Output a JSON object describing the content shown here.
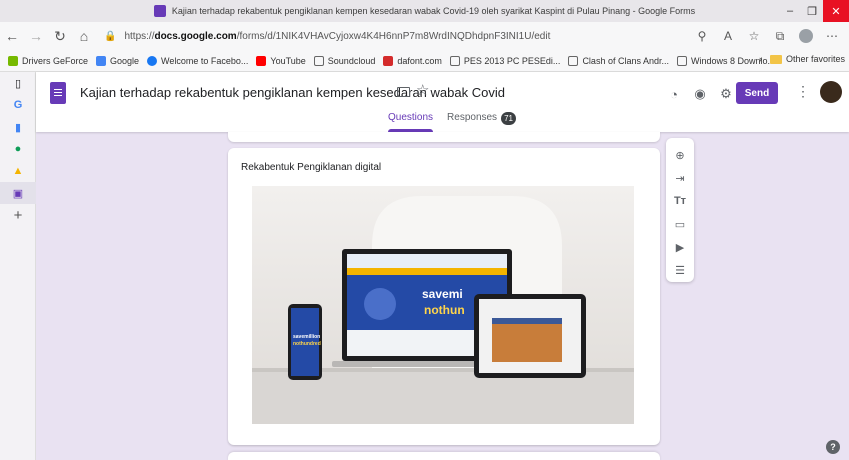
{
  "window": {
    "title": "Kajian terhadap rekabentuk pengiklanan kempen kesedaran wabak Covid-19 oleh syarikat Kaspint di Pulau Pinang - Google Forms",
    "minimize": "–",
    "maximize": "❐",
    "close": "✕"
  },
  "browser": {
    "url_prefix": "https://",
    "url_domain": "docs.google.com",
    "url_path": "/forms/d/1NIK4VHAvCyjoxw4K4H6nnP7m8WrdINQDhdpnF3INI1U/edit",
    "bookmarks": [
      {
        "label": "Drivers GeForce",
        "icon": "nvidia-icon",
        "color": "#76b900"
      },
      {
        "label": "Google",
        "icon": "google-icon",
        "color": "#4285f4"
      },
      {
        "label": "Welcome to Facebo...",
        "icon": "facebook-icon",
        "color": "#1877f2"
      },
      {
        "label": "YouTube",
        "icon": "youtube-icon",
        "color": "#ff0000"
      },
      {
        "label": "Soundcloud",
        "icon": "page-icon",
        "color": "#ffffff"
      },
      {
        "label": "dafont.com",
        "icon": "dafont-icon",
        "color": "#d42b2b"
      },
      {
        "label": "PES 2013 PC PESEdi...",
        "icon": "page-icon",
        "color": "#ffffff"
      },
      {
        "label": "Clash of Clans Andr...",
        "icon": "page-icon",
        "color": "#ffffff"
      },
      {
        "label": "Windows 8 Downlo...",
        "icon": "page-icon",
        "color": "#ffffff"
      }
    ],
    "other_favorites": "Other favorites"
  },
  "form": {
    "title": "Kajian terhadap rekabentuk pengiklanan kempen kesedaran wabak Covid",
    "send_label": "Send",
    "tabs": [
      {
        "label": "Questions",
        "active": true
      },
      {
        "label": "Responses",
        "active": false,
        "count": "71"
      }
    ],
    "accent": "#673ab7"
  },
  "card": {
    "title": "Rekabentuk Pengiklanan digital",
    "image_alt_text": {
      "banner_line1": "savemi",
      "banner_line2": "nothun",
      "phone_line1": "savemillion",
      "phone_line2": "nothundred"
    }
  },
  "toolbar": [
    "add-question-icon",
    "import-questions-icon",
    "add-title-icon",
    "add-image-icon",
    "add-video-icon",
    "add-section-icon"
  ],
  "help": "?"
}
